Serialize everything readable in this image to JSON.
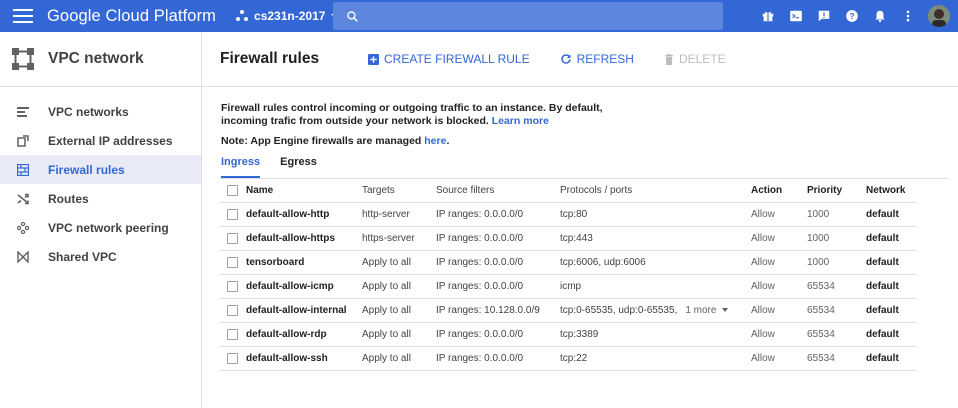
{
  "header": {
    "brand": "Google Cloud Platform",
    "project": "cs231n-2017",
    "search_placeholder": ""
  },
  "sidebar": {
    "title": "VPC network",
    "items": [
      {
        "label": "VPC networks",
        "icon": "vpc-networks-icon",
        "active": false
      },
      {
        "label": "External IP addresses",
        "icon": "external-ip-icon",
        "active": false
      },
      {
        "label": "Firewall rules",
        "icon": "firewall-icon",
        "active": true
      },
      {
        "label": "Routes",
        "icon": "routes-icon",
        "active": false
      },
      {
        "label": "VPC network peering",
        "icon": "peering-icon",
        "active": false
      },
      {
        "label": "Shared VPC",
        "icon": "shared-vpc-icon",
        "active": false
      }
    ]
  },
  "main": {
    "title": "Firewall rules",
    "actions": {
      "create": "CREATE FIREWALL RULE",
      "refresh": "REFRESH",
      "delete": "DELETE"
    },
    "description_line1": "Firewall rules control incoming or outgoing traffic to an instance. By default,",
    "description_line2": "incoming trafic from outside your network is blocked.",
    "learn_more": "Learn more",
    "note_prefix": "Note: App Engine firewalls are managed",
    "note_link": "here",
    "note_suffix": ".",
    "tabs": {
      "ingress": "Ingress",
      "egress": "Egress"
    }
  },
  "table": {
    "columns": {
      "name": "Name",
      "targets": "Targets",
      "source": "Source filters",
      "protocols": "Protocols / ports",
      "action": "Action",
      "priority": "Priority",
      "network": "Network"
    },
    "rows": [
      {
        "name": "default-allow-http",
        "targets": "http-server",
        "source": "IP ranges: 0.0.0.0/0",
        "protocols": "tcp:80",
        "more": "",
        "action": "Allow",
        "priority": "1000",
        "network": "default"
      },
      {
        "name": "default-allow-https",
        "targets": "https-server",
        "source": "IP ranges: 0.0.0.0/0",
        "protocols": "tcp:443",
        "more": "",
        "action": "Allow",
        "priority": "1000",
        "network": "default"
      },
      {
        "name": "tensorboard",
        "targets": "Apply to all",
        "source": "IP ranges: 0.0.0.0/0",
        "protocols": "tcp:6006, udp:6006",
        "more": "",
        "action": "Allow",
        "priority": "1000",
        "network": "default"
      },
      {
        "name": "default-allow-icmp",
        "targets": "Apply to all",
        "source": "IP ranges: 0.0.0.0/0",
        "protocols": "icmp",
        "more": "",
        "action": "Allow",
        "priority": "65534",
        "network": "default"
      },
      {
        "name": "default-allow-internal",
        "targets": "Apply to all",
        "source": "IP ranges: 10.128.0.0/9",
        "protocols": "tcp:0-65535, udp:0-65535,",
        "more": "1 more",
        "action": "Allow",
        "priority": "65534",
        "network": "default"
      },
      {
        "name": "default-allow-rdp",
        "targets": "Apply to all",
        "source": "IP ranges: 0.0.0.0/0",
        "protocols": "tcp:3389",
        "more": "",
        "action": "Allow",
        "priority": "65534",
        "network": "default"
      },
      {
        "name": "default-allow-ssh",
        "targets": "Apply to all",
        "source": "IP ranges: 0.0.0.0/0",
        "protocols": "tcp:22",
        "more": "",
        "action": "Allow",
        "priority": "65534",
        "network": "default"
      }
    ]
  },
  "colors": {
    "topbar": "#3367d6",
    "accent": "#3367d6",
    "active_nav_bg": "#e8eaf6"
  }
}
